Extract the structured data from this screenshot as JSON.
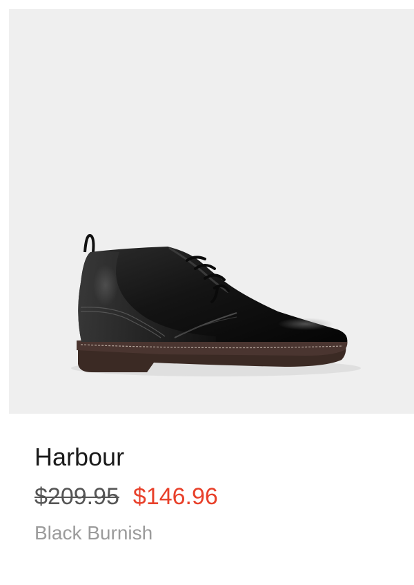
{
  "product": {
    "name": "Harbour",
    "original_price": "$209.95",
    "sale_price": "$146.96",
    "color_name": "Black Burnish",
    "image_icon": "chukka-boot-image"
  },
  "colors": {
    "image_background": "#efefef",
    "sale_price": "#e8402a",
    "original_price": "#555555",
    "color_text": "#9b9b9b",
    "name_text": "#1a1a1a"
  }
}
